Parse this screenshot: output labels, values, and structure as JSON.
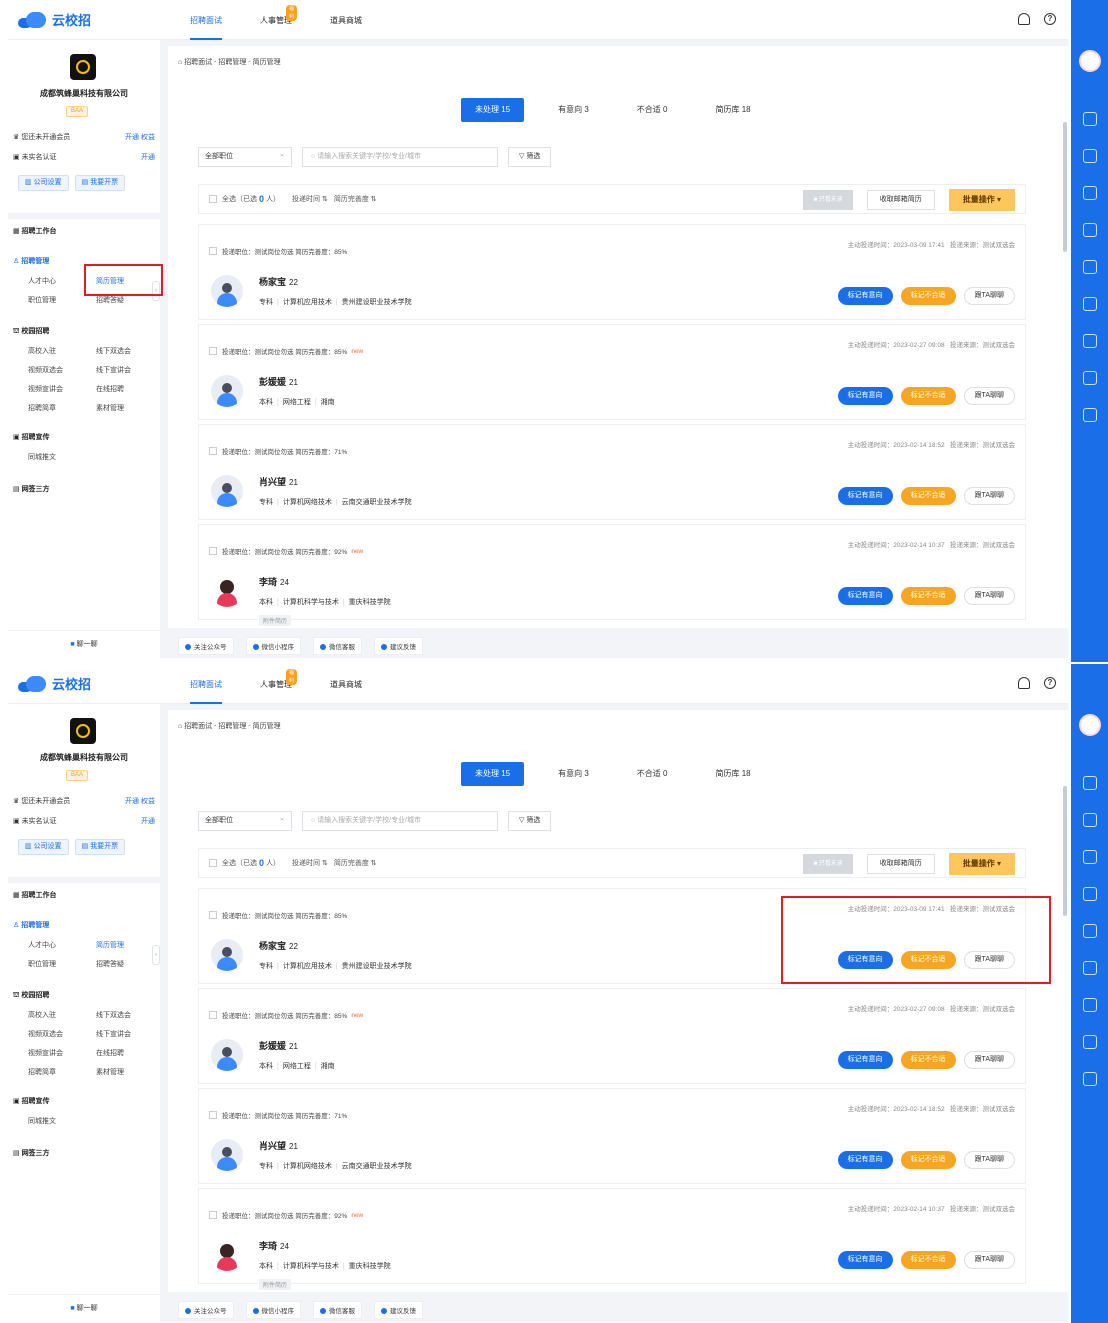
{
  "app": {
    "logo_text": "云校招"
  },
  "nav": {
    "items": [
      {
        "label": "招聘面试",
        "active": true,
        "badge": ""
      },
      {
        "label": "人事管理",
        "active": false,
        "badge": "福利"
      },
      {
        "label": "道具商城",
        "active": false,
        "badge": ""
      }
    ]
  },
  "sidebar": {
    "company_name": "成都筑蜂巢科技有限公司",
    "company_badge": "BAA",
    "member_text": "您还未开通会员",
    "member_link1": "开通",
    "member_link2": "权益",
    "verify_text": "未实名认证",
    "verify_link": "开通",
    "btn_company": "公司设置",
    "btn_invoice": "我要开票",
    "workbench": "招聘工作台",
    "recruit_manage": "招聘管理",
    "recruit_items": [
      "人才中心",
      "简历管理",
      "职位管理",
      "招聘答疑"
    ],
    "campus": "校园招聘",
    "campus_items": [
      "高校入驻",
      "线下双选会",
      "视频双选会",
      "线下宣讲会",
      "视频宣讲会",
      "在线招聘",
      "招聘简章",
      "素材管理"
    ],
    "promo": "招聘宣传",
    "promo_items": [
      "同城推文"
    ],
    "sign": "网签三方",
    "chat": "聊一聊"
  },
  "main": {
    "breadcrumb": "招聘面试 - 招聘管理 - 简历管理",
    "tabs": [
      "未处理 15",
      "有意向 3",
      "不合适 0",
      "简历库 18"
    ],
    "position_select": "全部职位",
    "search_placeholder": "请输入搜索关键字/学校/专业/城市",
    "filter_btn": "筛选",
    "select_all": "全选（已选",
    "selected_count": "0",
    "selected_suffix": "人）",
    "sort_time": "投递时间 ⇅",
    "sort_complete": "简历完善度 ⇅",
    "btn_export": "只看未读",
    "btn_mailbox": "收取邮箱简历",
    "btn_batch": "批量操作 ▾",
    "action_intent": "标记有意向",
    "action_reject": "标记不合适",
    "action_chat": "跟TA聊聊",
    "candidates": [
      {
        "applied": "投递职位：测试岗位勿选 简历完善度：85%",
        "new": "",
        "time": "主动投递时间：2023-03-09 17:41",
        "source": "投递来源：测试双选会",
        "name": "杨家宝",
        "age": "22",
        "degree": "专科",
        "major": "计算机应用技术",
        "school": "贵州建设职业技术学院",
        "attach": "",
        "female": false
      },
      {
        "applied": "投递职位：测试岗位勿选 简历完善度：85%",
        "new": "new",
        "time": "主动投递时间：2023-02-27 09:08",
        "source": "投递来源：测试双选会",
        "name": "彭媛媛",
        "age": "21",
        "degree": "本科",
        "major": "网络工程",
        "school": "湘南",
        "attach": "",
        "female": false
      },
      {
        "applied": "投递职位：测试岗位勿选 简历完善度：71%",
        "new": "",
        "time": "主动投递时间：2023-02-14 18:52",
        "source": "投递来源：测试双选会",
        "name": "肖兴望",
        "age": "21",
        "degree": "专科",
        "major": "计算机网络技术",
        "school": "云南交通职业技术学院",
        "attach": "",
        "female": false
      },
      {
        "applied": "投递职位：测试岗位勿选 简历完善度：92%",
        "new": "new",
        "time": "主动投递时间：2023-02-14 10:37",
        "source": "投递来源：测试双选会",
        "name": "李琦",
        "age": "24",
        "degree": "本科",
        "major": "计算机科学与技术",
        "school": "重庆科技学院",
        "attach": "附件简历",
        "female": true
      }
    ]
  },
  "footer": {
    "items": [
      "关注公众号",
      "微信小程序",
      "微信客服",
      "建议反馈"
    ]
  },
  "colors": {
    "accent": "#1a6fe8",
    "orange": "#f6a623",
    "highlight": "#e02020"
  }
}
